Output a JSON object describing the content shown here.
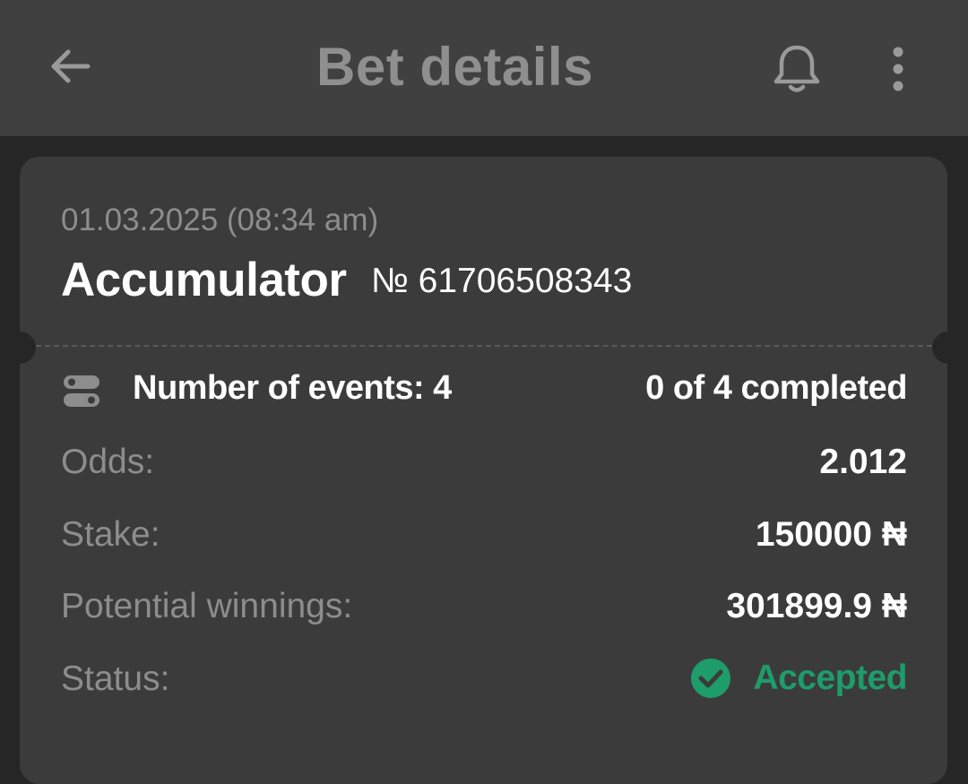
{
  "header": {
    "title": "Bet details"
  },
  "bet": {
    "date": "01.03.2025 (08:34 am)",
    "type": "Accumulator",
    "number": "№ 61706508343",
    "events_label": "Number of events: 4",
    "events_completed": "0 of 4 completed",
    "odds_label": "Odds:",
    "odds_value": "2.012",
    "stake_label": "Stake:",
    "stake_value": "150000 ₦",
    "winnings_label": "Potential winnings:",
    "winnings_value": "301899.9 ₦",
    "status_label": "Status:",
    "status_value": "Accepted"
  },
  "icons": {
    "back": "arrow-left-icon",
    "bell": "bell-icon",
    "more": "more-vertical-icon",
    "events": "toggle-list-icon",
    "status": "check-circle-icon"
  },
  "colors": {
    "background": "#262626",
    "header_bg": "#404040",
    "card_bg": "#3b3b3b",
    "title": "#8f8f8f",
    "muted_text": "#8d8d8d",
    "accent_green": "#1e9c6a"
  }
}
